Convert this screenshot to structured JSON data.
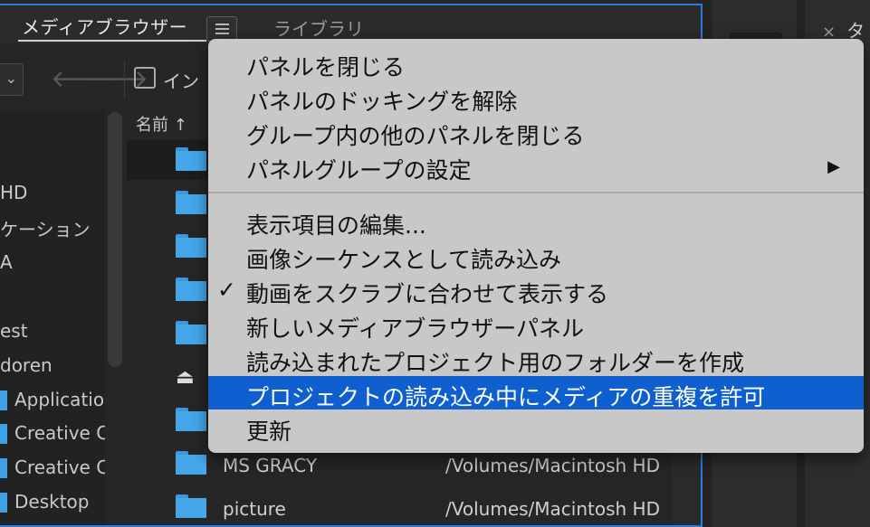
{
  "panel": {
    "active_tab": "メディアブラウザー",
    "menu_icon": "hamburger-menu-icon",
    "library_tab": "ライブラリ",
    "ingest_label": "イン",
    "name_column": "名前 ↑"
  },
  "tree": [
    {
      "label": "HD"
    },
    {
      "label": "ケーション"
    },
    {
      "label": "A"
    },
    {
      "label": ""
    },
    {
      "label": "est"
    },
    {
      "label": "doren"
    },
    {
      "label": "Applicatio"
    },
    {
      "label": "Creative C"
    },
    {
      "label": "Creative C"
    },
    {
      "label": "Desktop"
    }
  ],
  "files": [
    {
      "name": "MS GRACY",
      "path": "/Volumes/Macintosh HD"
    },
    {
      "name": "picture",
      "path": "/Volumes/Macintosh HD"
    }
  ],
  "right_panel": {
    "tab_close": "×",
    "tab_label": "タ"
  },
  "menu": {
    "group1": [
      {
        "label": "パネルを閉じる"
      },
      {
        "label": "パネルのドッキングを解除"
      },
      {
        "label": "グループ内の他のパネルを閉じる"
      },
      {
        "label": "パネルグループの設定",
        "submenu_arrow": "▶"
      }
    ],
    "group2": [
      {
        "label": "表示項目の編集..."
      },
      {
        "label": "画像シーケンスとして読み込み"
      },
      {
        "label": "動画をスクラブに合わせて表示する",
        "checked": true,
        "check_mark": "✓"
      },
      {
        "label": "新しいメディアブラウザーパネル"
      },
      {
        "label": "読み込まれたプロジェクト用のフォルダーを作成"
      },
      {
        "label": "プロジェクトの読み込み中にメディアの重複を許可",
        "highlighted": true
      },
      {
        "label": "更新"
      }
    ],
    "highlight_color": "#0f5fcf"
  }
}
